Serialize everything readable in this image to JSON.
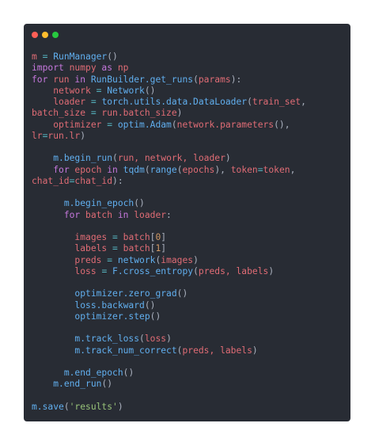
{
  "window": {
    "controls": [
      {
        "name": "close-button-dot",
        "color": "#ff5f56"
      },
      {
        "name": "minimize-button-dot",
        "color": "#ffbd2e"
      },
      {
        "name": "maximize-button-dot",
        "color": "#27c93f"
      }
    ]
  },
  "colors": {
    "background": "#282c34",
    "keyword": "#c678dd",
    "function": "#61afef",
    "identifier": "#e06c75",
    "operator": "#56b6c2",
    "number": "#d19a66",
    "string": "#98c379",
    "default": "#abb2bf"
  },
  "code": [
    [
      [
        "ident",
        "m"
      ],
      [
        "op",
        " = "
      ],
      [
        "func",
        "RunManager"
      ],
      [
        "default",
        "()"
      ]
    ],
    [
      [
        "keyword",
        "import"
      ],
      [
        "ident",
        " numpy "
      ],
      [
        "keyword",
        "as"
      ],
      [
        "ident",
        " np"
      ]
    ],
    [
      [
        "keyword",
        "for"
      ],
      [
        "ident",
        " run "
      ],
      [
        "keyword",
        "in"
      ],
      [
        "func",
        " RunBuilder.get_runs"
      ],
      [
        "default",
        "("
      ],
      [
        "ident",
        "params"
      ],
      [
        "default",
        "):"
      ]
    ],
    [
      [
        "default",
        "    "
      ],
      [
        "ident",
        "network"
      ],
      [
        "op",
        " = "
      ],
      [
        "func",
        "Network"
      ],
      [
        "default",
        "()"
      ]
    ],
    [
      [
        "default",
        "    "
      ],
      [
        "ident",
        "loader"
      ],
      [
        "op",
        " = "
      ],
      [
        "func",
        "torch.utils.data.DataLoader"
      ],
      [
        "default",
        "("
      ],
      [
        "ident",
        "train_set"
      ],
      [
        "default",
        ","
      ]
    ],
    [
      [
        "ident",
        "batch_size"
      ],
      [
        "op",
        " = "
      ],
      [
        "ident",
        "run.batch_size"
      ],
      [
        "default",
        ")"
      ]
    ],
    [
      [
        "default",
        "    "
      ],
      [
        "ident",
        "optimizer"
      ],
      [
        "op",
        " = "
      ],
      [
        "func",
        "optim.Adam"
      ],
      [
        "default",
        "("
      ],
      [
        "ident",
        "network.parameters"
      ],
      [
        "default",
        "(),"
      ]
    ],
    [
      [
        "ident",
        "lr"
      ],
      [
        "op",
        "="
      ],
      [
        "ident",
        "run.lr"
      ],
      [
        "default",
        ")"
      ]
    ],
    [],
    [
      [
        "default",
        "    "
      ],
      [
        "func",
        "m.begin_run"
      ],
      [
        "default",
        "("
      ],
      [
        "ident",
        "run, network, loader"
      ],
      [
        "default",
        ")"
      ]
    ],
    [
      [
        "default",
        "    "
      ],
      [
        "keyword",
        "for"
      ],
      [
        "ident",
        " epoch "
      ],
      [
        "keyword",
        "in"
      ],
      [
        "func",
        " tqdm"
      ],
      [
        "default",
        "("
      ],
      [
        "func",
        "range"
      ],
      [
        "default",
        "("
      ],
      [
        "ident",
        "epochs"
      ],
      [
        "default",
        "), "
      ],
      [
        "ident",
        "token"
      ],
      [
        "op",
        "="
      ],
      [
        "ident",
        "token"
      ],
      [
        "default",
        ","
      ]
    ],
    [
      [
        "ident",
        "chat_id"
      ],
      [
        "op",
        "="
      ],
      [
        "ident",
        "chat_id"
      ],
      [
        "default",
        "):"
      ]
    ],
    [],
    [
      [
        "default",
        "      "
      ],
      [
        "func",
        "m.begin_epoch"
      ],
      [
        "default",
        "()"
      ]
    ],
    [
      [
        "default",
        "      "
      ],
      [
        "keyword",
        "for"
      ],
      [
        "ident",
        " batch "
      ],
      [
        "keyword",
        "in"
      ],
      [
        "ident",
        " loader"
      ],
      [
        "default",
        ":"
      ]
    ],
    [],
    [
      [
        "default",
        "        "
      ],
      [
        "ident",
        "images"
      ],
      [
        "op",
        " = "
      ],
      [
        "ident",
        "batch"
      ],
      [
        "default",
        "["
      ],
      [
        "number",
        "0"
      ],
      [
        "default",
        "]"
      ]
    ],
    [
      [
        "default",
        "        "
      ],
      [
        "ident",
        "labels"
      ],
      [
        "op",
        " = "
      ],
      [
        "ident",
        "batch"
      ],
      [
        "default",
        "["
      ],
      [
        "number",
        "1"
      ],
      [
        "default",
        "]"
      ]
    ],
    [
      [
        "default",
        "        "
      ],
      [
        "ident",
        "preds"
      ],
      [
        "op",
        " = "
      ],
      [
        "func",
        "network"
      ],
      [
        "default",
        "("
      ],
      [
        "ident",
        "images"
      ],
      [
        "default",
        ")"
      ]
    ],
    [
      [
        "default",
        "        "
      ],
      [
        "ident",
        "loss"
      ],
      [
        "op",
        " = "
      ],
      [
        "func",
        "F.cross_entropy"
      ],
      [
        "default",
        "("
      ],
      [
        "ident",
        "preds, labels"
      ],
      [
        "default",
        ")"
      ]
    ],
    [],
    [
      [
        "default",
        "        "
      ],
      [
        "func",
        "optimizer.zero_grad"
      ],
      [
        "default",
        "()"
      ]
    ],
    [
      [
        "default",
        "        "
      ],
      [
        "func",
        "loss.backward"
      ],
      [
        "default",
        "()"
      ]
    ],
    [
      [
        "default",
        "        "
      ],
      [
        "func",
        "optimizer.step"
      ],
      [
        "default",
        "()"
      ]
    ],
    [],
    [
      [
        "default",
        "        "
      ],
      [
        "func",
        "m.track_loss"
      ],
      [
        "default",
        "("
      ],
      [
        "ident",
        "loss"
      ],
      [
        "default",
        ")"
      ]
    ],
    [
      [
        "default",
        "        "
      ],
      [
        "func",
        "m.track_num_correct"
      ],
      [
        "default",
        "("
      ],
      [
        "ident",
        "preds, labels"
      ],
      [
        "default",
        ")"
      ]
    ],
    [],
    [
      [
        "default",
        "      "
      ],
      [
        "func",
        "m.end_epoch"
      ],
      [
        "default",
        "()"
      ]
    ],
    [
      [
        "default",
        "    "
      ],
      [
        "func",
        "m.end_run"
      ],
      [
        "default",
        "()"
      ]
    ],
    [],
    [
      [
        "func",
        "m.save"
      ],
      [
        "default",
        "("
      ],
      [
        "string",
        "'results'"
      ],
      [
        "default",
        ")"
      ]
    ]
  ]
}
